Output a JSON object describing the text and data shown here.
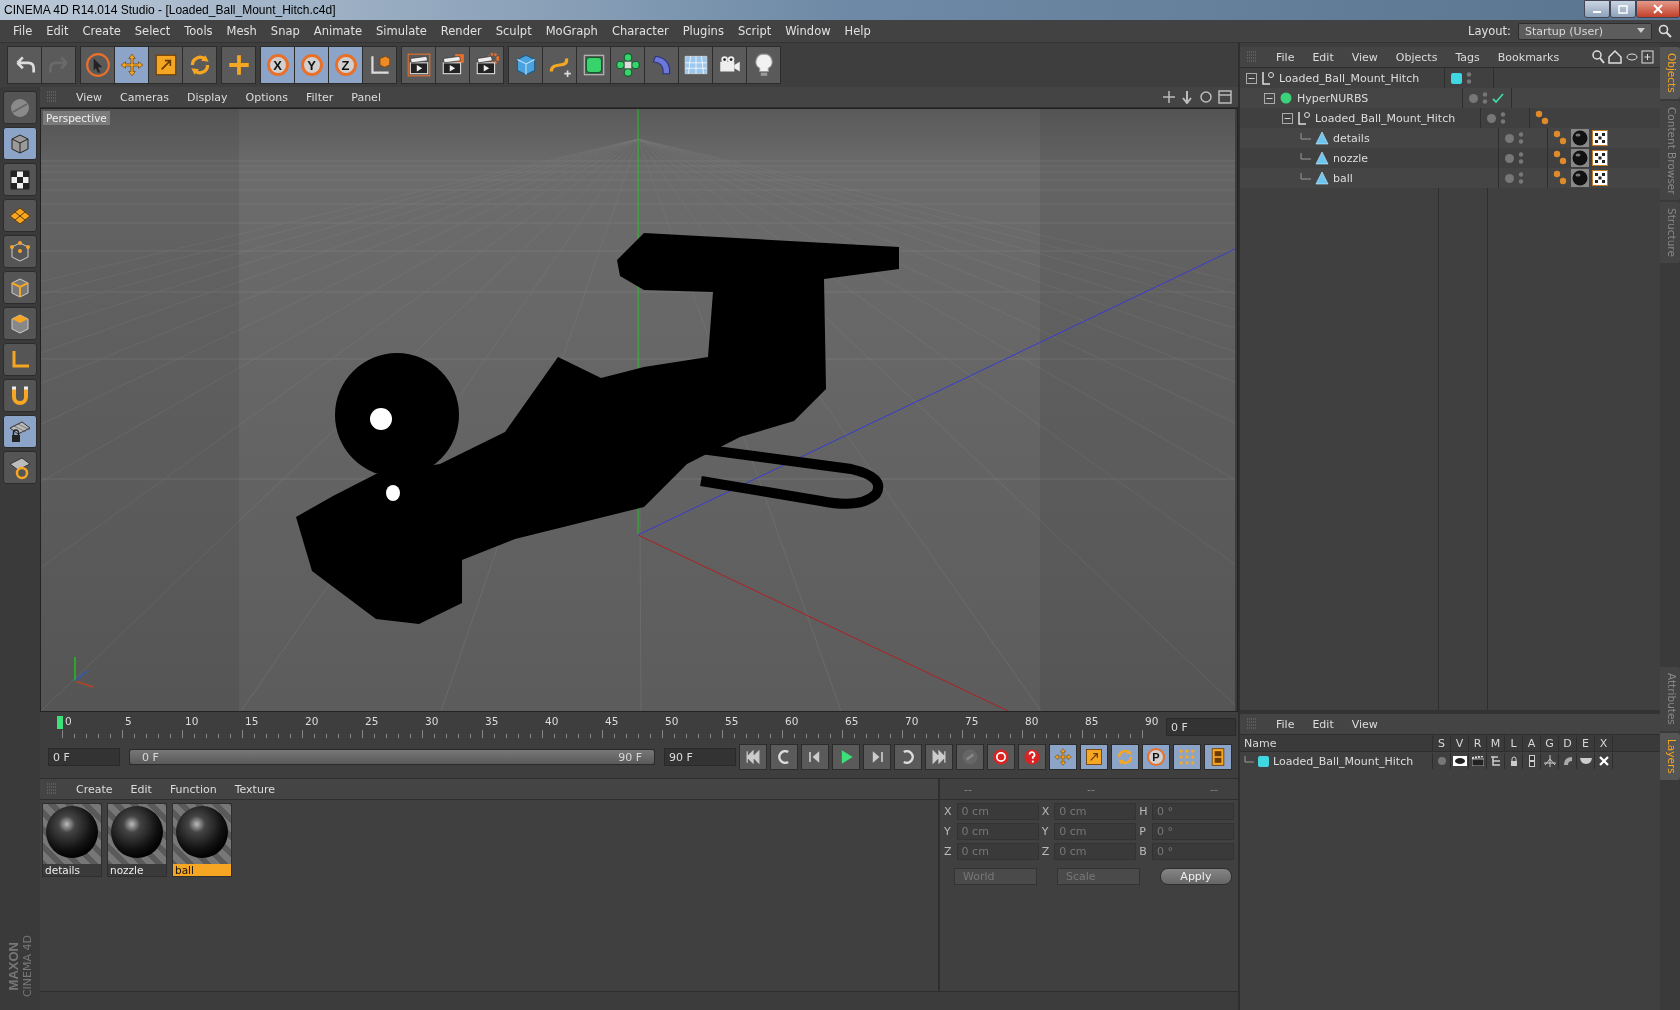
{
  "window": {
    "title": "CINEMA 4D R14.014 Studio - [Loaded_Ball_Mount_Hitch.c4d]"
  },
  "menu_bar": [
    "File",
    "Edit",
    "Create",
    "Select",
    "Tools",
    "Mesh",
    "Snap",
    "Animate",
    "Simulate",
    "Render",
    "Sculpt",
    "MoGraph",
    "Character",
    "Plugins",
    "Script",
    "Window",
    "Help"
  ],
  "layout": {
    "label": "Layout:",
    "value": "Startup (User)"
  },
  "toolbar": {
    "groups": [
      [
        {
          "kind": "undo",
          "selected": false
        },
        {
          "kind": "redo",
          "selected": false
        }
      ],
      [
        {
          "kind": "cursor",
          "selected": false
        },
        {
          "kind": "move",
          "selected": true
        },
        {
          "kind": "scale",
          "selected": false
        },
        {
          "kind": "rotate",
          "selected": false
        }
      ],
      [
        {
          "kind": "add",
          "selected": false
        }
      ],
      [
        {
          "kind": "axis",
          "label": "X",
          "selected": true
        },
        {
          "kind": "axis",
          "label": "Y",
          "selected": true
        },
        {
          "kind": "axis",
          "label": "Z",
          "selected": true
        },
        {
          "kind": "coord",
          "selected": false
        }
      ],
      [
        {
          "kind": "render-view",
          "selected": false
        },
        {
          "kind": "render-picture",
          "selected": false
        },
        {
          "kind": "render-settings",
          "selected": false
        }
      ],
      [
        {
          "kind": "cube",
          "selected": false
        },
        {
          "kind": "spline",
          "selected": false
        },
        {
          "kind": "nurbs",
          "selected": false
        },
        {
          "kind": "array",
          "selected": false
        },
        {
          "kind": "deformer",
          "selected": false
        },
        {
          "kind": "floor",
          "selected": false
        },
        {
          "kind": "camera",
          "selected": false
        },
        {
          "kind": "light",
          "selected": false
        }
      ]
    ]
  },
  "left_tools": [
    {
      "kind": "sphere",
      "selected": false
    },
    {
      "kind": "model",
      "selected": true
    },
    {
      "kind": "texture",
      "selected": false
    },
    {
      "kind": "workplane",
      "selected": false
    },
    {
      "kind": "points",
      "selected": false
    },
    {
      "kind": "edges",
      "selected": false
    },
    {
      "kind": "polygons",
      "selected": false
    },
    {
      "kind": "axis-mode",
      "selected": false
    },
    {
      "kind": "magnet",
      "selected": false
    },
    {
      "kind": "snap-lock",
      "selected": true
    },
    {
      "kind": "grid-snap",
      "selected": false
    }
  ],
  "brand": {
    "maker": "MAXON",
    "product": "CINEMA 4D"
  },
  "viewport": {
    "menus": [
      "View",
      "Cameras",
      "Display",
      "Options",
      "Filter",
      "Panel"
    ],
    "camera_label": "Perspective"
  },
  "timeline": {
    "ticks": [
      "0",
      "5",
      "10",
      "15",
      "20",
      "25",
      "30",
      "35",
      "40",
      "45",
      "50",
      "55",
      "60",
      "65",
      "70",
      "75",
      "80",
      "85",
      "90"
    ],
    "current": "0 F"
  },
  "transport": {
    "start": "0 F",
    "range_start": "0 F",
    "range_end": "90 F",
    "level": 1,
    "end": "90 F",
    "buttons": [
      {
        "kind": "first",
        "selected": false
      },
      {
        "kind": "prev-key",
        "selected": false
      },
      {
        "kind": "prev",
        "selected": false
      },
      {
        "kind": "play",
        "selected": false
      },
      {
        "kind": "next",
        "selected": false
      },
      {
        "kind": "next-key",
        "selected": false
      },
      {
        "kind": "last",
        "selected": false
      },
      {
        "kind": "keys",
        "selected": false
      },
      {
        "kind": "record",
        "selected": false
      },
      {
        "kind": "help",
        "selected": false
      },
      {
        "kind": "move",
        "selected": true
      },
      {
        "kind": "scale",
        "selected": true
      },
      {
        "kind": "rotate",
        "selected": true
      },
      {
        "kind": "param",
        "label": "P",
        "selected": true
      },
      {
        "kind": "dots",
        "selected": true
      },
      {
        "kind": "film",
        "selected": true
      }
    ]
  },
  "material_manager": {
    "menus": [
      "Create",
      "Edit",
      "Function",
      "Texture"
    ],
    "materials": [
      {
        "name": "details",
        "selected": false
      },
      {
        "name": "nozzle",
        "selected": false
      },
      {
        "name": "ball",
        "selected": true
      }
    ]
  },
  "coordinates": {
    "headers": [
      "--",
      "--",
      "--"
    ],
    "rows": [
      [
        {
          "label": "X",
          "value": "0 cm"
        },
        {
          "label": "X",
          "value": "0 cm"
        },
        {
          "label": "H",
          "value": "0 °"
        }
      ],
      [
        {
          "label": "Y",
          "value": "0 cm"
        },
        {
          "label": "Y",
          "value": "0 cm"
        },
        {
          "label": "P",
          "value": "0 °"
        }
      ],
      [
        {
          "label": "Z",
          "value": "0 cm"
        },
        {
          "label": "Z",
          "value": "0 cm"
        },
        {
          "label": "B",
          "value": "0 °"
        }
      ]
    ],
    "dropdowns": [
      "World",
      "Scale"
    ],
    "apply": "Apply"
  },
  "object_manager": {
    "menus": [
      "File",
      "Edit",
      "View",
      "Objects",
      "Tags",
      "Bookmarks"
    ],
    "objects": [
      {
        "name": "Loaded_Ball_Mount_Hitch",
        "kind": "null",
        "color": "#3fd8e2",
        "expanded": true,
        "children": [
          {
            "name": "HyperNURBS",
            "kind": "nurbs",
            "enabled": true,
            "expanded": true,
            "children": [
              {
                "name": "Loaded_Ball_Mount_Hitch",
                "kind": "null",
                "expanded": true,
                "tags": [
                  {
                    "kind": "phong"
                  }
                ],
                "children": [
                  {
                    "name": "details",
                    "kind": "polygon",
                    "tags": [
                      {
                        "kind": "phong"
                      },
                      {
                        "kind": "material"
                      },
                      {
                        "kind": "texture"
                      }
                    ]
                  },
                  {
                    "name": "nozzle",
                    "kind": "polygon",
                    "tags": [
                      {
                        "kind": "phong"
                      },
                      {
                        "kind": "material"
                      },
                      {
                        "kind": "texture"
                      }
                    ]
                  },
                  {
                    "name": "ball",
                    "kind": "polygon",
                    "tags": [
                      {
                        "kind": "phong"
                      },
                      {
                        "kind": "material"
                      },
                      {
                        "kind": "texture"
                      }
                    ]
                  }
                ]
              }
            ]
          }
        ]
      }
    ]
  },
  "side_tabs": [
    {
      "label": "Objects",
      "selected": true
    },
    {
      "label": "Content Browser",
      "selected": false
    },
    {
      "label": "Structure",
      "selected": false
    }
  ],
  "layers_panel": {
    "menus": [
      "File",
      "Edit",
      "View"
    ],
    "columns": [
      "Name",
      "S",
      "V",
      "R",
      "M",
      "L",
      "A",
      "G",
      "D",
      "E",
      "X"
    ],
    "layers": [
      {
        "name": "Loaded_Ball_Mount_Hitch",
        "color": "#3fd8e2"
      }
    ]
  },
  "lower_side_tabs": [
    {
      "label": "Attributes",
      "selected": false
    },
    {
      "label": "Layers",
      "selected": true
    }
  ]
}
